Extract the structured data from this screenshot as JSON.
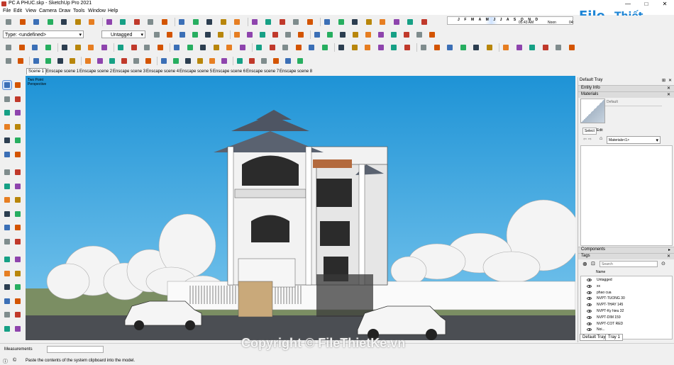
{
  "window": {
    "title": "PC A PHUC.skp - SketchUp Pro 2021",
    "minimize": "—",
    "maximize": "□",
    "close": "✕"
  },
  "menu": [
    "File",
    "Edit",
    "View",
    "Camera",
    "Draw",
    "Tools",
    "Window",
    "Help"
  ],
  "toolbar": {
    "type_combo": "Type: <undefined>",
    "tag_combo": "Untagged",
    "shadow_months": "J F M A M J J A S O N D",
    "time_start": "05:43 AM",
    "time_noon": "Noon",
    "time_end": "04:"
  },
  "scenes": [
    "Scene 1",
    "Enscape scene 1",
    "Enscape scene 2",
    "Enscape scene 3",
    "Enscape scene 4",
    "Enscape scene 5",
    "Enscape scene 6",
    "Enscape scene 7",
    "Enscape scene 8"
  ],
  "viewport": {
    "label_line1": "Two Point",
    "label_line2": "Perspective"
  },
  "tray": {
    "title": "Default Tray",
    "pin": "⊞",
    "close": "✕",
    "entity_info": "Entity Info",
    "materials": "Materials",
    "material_default": "Default",
    "select_tab": "Select",
    "edit_tab": "Edit",
    "materials_combo": "Materials<1>",
    "components": "Components",
    "tags": "Tags",
    "search_placeholder": "Search",
    "name_header": "Name",
    "tags_list": [
      "Untagged",
      "xx",
      "phao cua",
      "NVPT-TUONG 30",
      "NVPT-THAY 145",
      "NVPT-Ky hieu 32",
      "NVPT-DIM 159",
      "NVPT-COT RED",
      "Noi..."
    ],
    "tabs": [
      "Default Tray",
      "Tray 1"
    ]
  },
  "status": {
    "measurements_label": "Measurements",
    "message": "Paste the contents of the system clipboard into the model."
  },
  "watermark": "Copyright © FileThietKe.vn",
  "logo": {
    "part1": "File",
    "part2": "Thiết Kế.vn"
  },
  "colors": {
    "sky": "#2ea3e0",
    "accent": "#1f86d6"
  }
}
